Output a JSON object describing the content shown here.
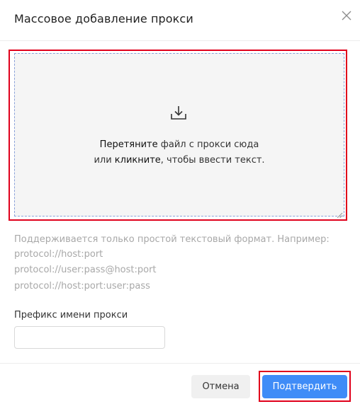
{
  "dialog": {
    "title": "Массовое добавление прокси",
    "close_icon": "close-icon"
  },
  "dropzone": {
    "icon": "download-icon",
    "line1_strong": "Перетяните",
    "line1_rest": " файл с прокси сюда",
    "line2_prefix": "или ",
    "line2_strong": "кликните",
    "line2_rest": ", чтобы ввести текст."
  },
  "hint": {
    "lines": [
      "Поддерживается только простой текстовый формат. Например:",
      "protocol://host:port",
      "protocol://user:pass@host:port",
      "protocol://host:port:user:pass"
    ]
  },
  "prefix": {
    "label": "Префикс имени прокси",
    "value": "",
    "placeholder": ""
  },
  "footer": {
    "cancel_label": "Отмена",
    "confirm_label": "Подтвердить"
  },
  "colors": {
    "highlight": "#e0001b",
    "primary": "#3f8cf7"
  }
}
